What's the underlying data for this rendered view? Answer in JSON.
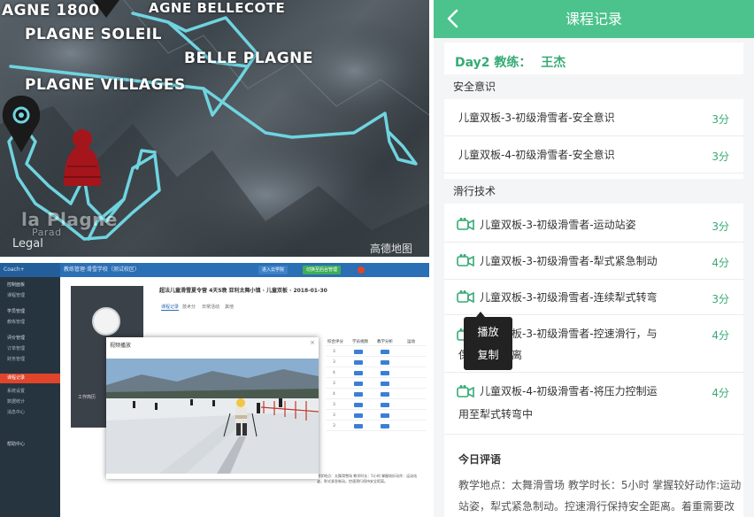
{
  "map": {
    "places": [
      "AGNE 1800",
      "AGNE BELLECOTE",
      "PLAGNE SOLEIL",
      "BELLE PLAGNE",
      "PLAGNE VILLAGES",
      "la Plagne",
      "Parad"
    ],
    "legal_text": "Legal",
    "provider_logo": "高德地图",
    "track_color": "#6fd4e0",
    "pin_color": "#1a1a1a",
    "hat_color": "#a5151c"
  },
  "coach": {
    "brand": "Coach+",
    "school": "教练管理·滑雪学校（测试校区）",
    "top_buttons": [
      "进入云学院",
      "切换至后台管理"
    ],
    "sidebar": [
      "控制面板",
      "课程管理",
      "学员管理",
      "教练管理",
      "课程记录",
      "评价管理",
      "订单管理",
      "财务管理",
      "系统设置",
      "数据统计",
      "消息中心",
      "帮助中心"
    ],
    "lesson_title": "超法儿童滑雪夏令营 4天5晚 亚利太舞小镇 · 儿童双板 · 2018-01-30",
    "tabs": [
      "课程记录",
      "技术分",
      "日常活动",
      "其他"
    ],
    "video_modal_title": "视频播放",
    "profile_label": "工作简历",
    "score_headers": [
      "综合评分",
      "学员视频",
      "教学分析",
      "运动"
    ],
    "score_values": [
      "3",
      "3",
      "4",
      "3",
      "4",
      "3",
      "3",
      "3"
    ],
    "eval_text": "教学地点：太舞滑雪场 教学时长：5小时 掌握较好动作：运动站姿，犁式紧急制动。控速滑行保持安全距离。"
  },
  "record": {
    "title": "课程记录",
    "day": "Day2",
    "coach_label": "教练：",
    "coach_name": "王杰",
    "categories": [
      {
        "name": "安全意识",
        "items": [
          {
            "label": "儿童双板-3-初级滑雪者-安全意识",
            "score": "3分",
            "has_video": false
          },
          {
            "label": "儿童双板-4-初级滑雪者-安全意识",
            "score": "3分",
            "has_video": false
          }
        ]
      },
      {
        "name": "滑行技术",
        "items": [
          {
            "label": "儿童双板-3-初级滑雪者-运动站姿",
            "score": "3分",
            "has_video": true
          },
          {
            "label": "儿童双板-3-初级滑雪者-犁式紧急制动",
            "score": "4分",
            "has_video": true
          },
          {
            "label": "儿童双板-3-初级滑雪者-连续犁式转弯",
            "score": "3分",
            "has_video": true
          },
          {
            "label_line1": "儿童双板-3-初级滑雪者-控速滑行，与",
            "label_line2": "保持安全距离",
            "score": "4分",
            "has_video": true
          },
          {
            "label_line1": "儿童双板-4-初级滑雪者-将压力控制运",
            "label_line2": "用至犁式转弯中",
            "score": "4分",
            "has_video": true
          }
        ]
      }
    ],
    "tooltip": [
      "播放",
      "复制"
    ],
    "evaluation_heading": "今日评语",
    "evaluation_line1": "教学地点：太舞滑雪场 教学时长：5小时 掌握较好动作:运动",
    "evaluation_line2": "站姿，犁式紧急制动。控速滑行保持安全距离。着重需要改",
    "theme": {
      "green": "#4cc28d",
      "score_green": "#35ab74"
    }
  }
}
